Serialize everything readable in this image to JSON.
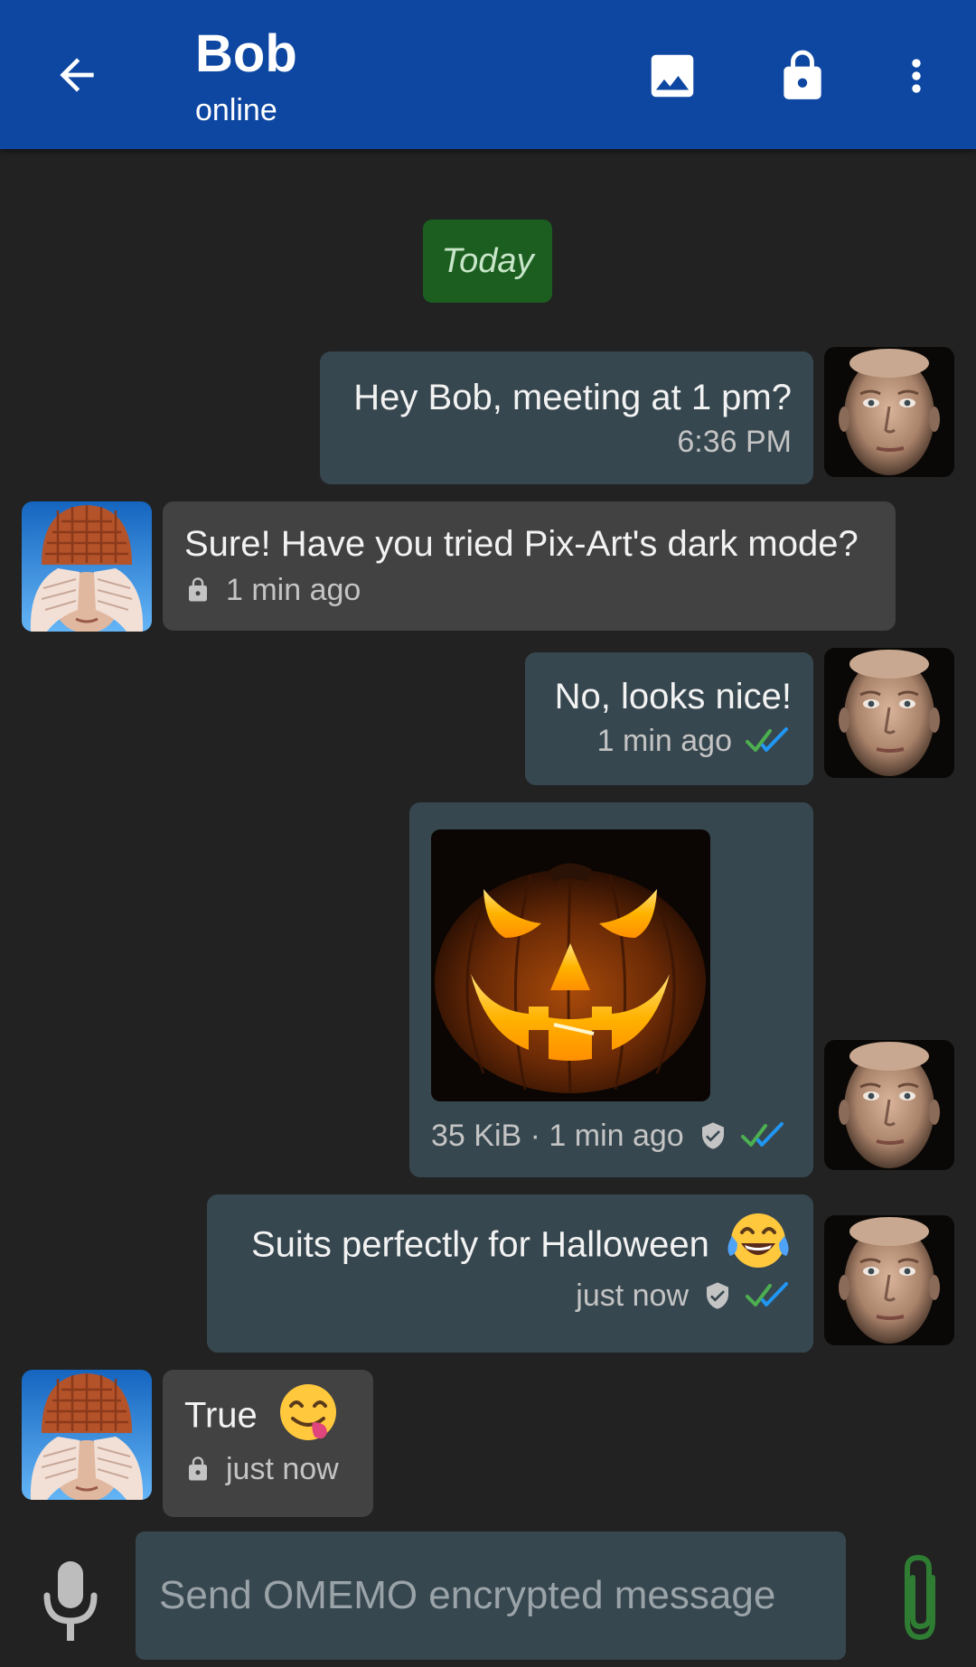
{
  "header": {
    "title": "Bob",
    "subtitle": "online",
    "back_icon": "arrow-left-icon",
    "actions": [
      "image-icon",
      "lock-icon",
      "more-vert-icon"
    ]
  },
  "date_chip": "Today",
  "messages": [
    {
      "direction": "out",
      "text": "Hey Bob, meeting at 1 pm?",
      "meta": "6:36 PM"
    },
    {
      "direction": "in",
      "text": "Sure! Have you tried Pix-Art's dark mode?",
      "meta": "1 min ago",
      "icons": [
        "lock-icon"
      ]
    },
    {
      "direction": "out",
      "text": "No, looks nice!",
      "meta": "1 min ago",
      "icons": [
        "double-check-icon"
      ]
    },
    {
      "direction": "out",
      "type": "image",
      "image": "jack-o-lantern",
      "meta": "35 KiB · 1 min ago",
      "icons": [
        "verified-shield-icon",
        "double-check-icon"
      ]
    },
    {
      "direction": "out",
      "text": "Suits perfectly for Halloween",
      "emoji": "face-with-tears-of-joy",
      "meta": "just now",
      "icons": [
        "verified-shield-icon",
        "double-check-icon"
      ]
    },
    {
      "direction": "in",
      "text": "True",
      "emoji": "face-savoring-food",
      "meta": "just now",
      "icons": [
        "lock-icon"
      ]
    }
  ],
  "composer": {
    "placeholder": "Send OMEMO encrypted message",
    "value": "",
    "left_icon": "microphone-icon",
    "right_icon": "paperclip-icon"
  },
  "colors": {
    "appbar": "#0d47a1",
    "background": "#222222",
    "bubble_out": "#37474f",
    "bubble_in": "#424242",
    "date_chip": "#1b5e20",
    "check_green": "#4caf50",
    "check_blue": "#2196f3"
  }
}
